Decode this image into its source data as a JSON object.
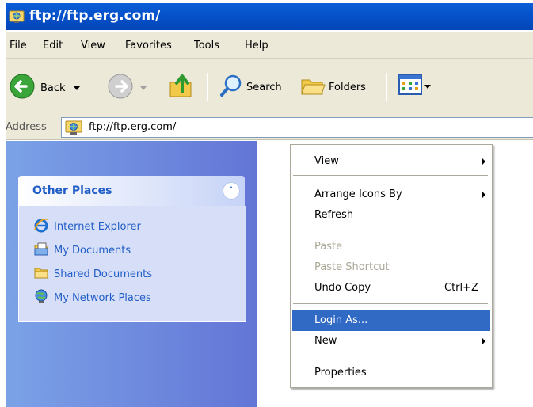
{
  "window": {
    "title": "ftp://ftp.erg.com/"
  },
  "menu": {
    "items": [
      "File",
      "Edit",
      "View",
      "Favorites",
      "Tools",
      "Help"
    ]
  },
  "toolbar": {
    "back_label": "Back",
    "search_label": "Search",
    "folders_label": "Folders"
  },
  "address": {
    "label": "Address",
    "value": "ftp://ftp.erg.com/"
  },
  "other_places": {
    "title": "Other Places",
    "items": [
      "Internet Explorer",
      "My Documents",
      "Shared Documents",
      "My Network Places"
    ]
  },
  "context_menu": {
    "view": "View",
    "arrange": "Arrange Icons By",
    "refresh": "Refresh",
    "paste": "Paste",
    "paste_shortcut": "Paste Shortcut",
    "undo_copy": "Undo Copy",
    "undo_copy_shortcut": "Ctrl+Z",
    "login_as": "Login As...",
    "new": "New",
    "properties": "Properties"
  },
  "colors": {
    "title_bar": "#0653cc",
    "task_pane": "#6f8fdf",
    "selection": "#316ac5",
    "link": "#215dc6"
  }
}
